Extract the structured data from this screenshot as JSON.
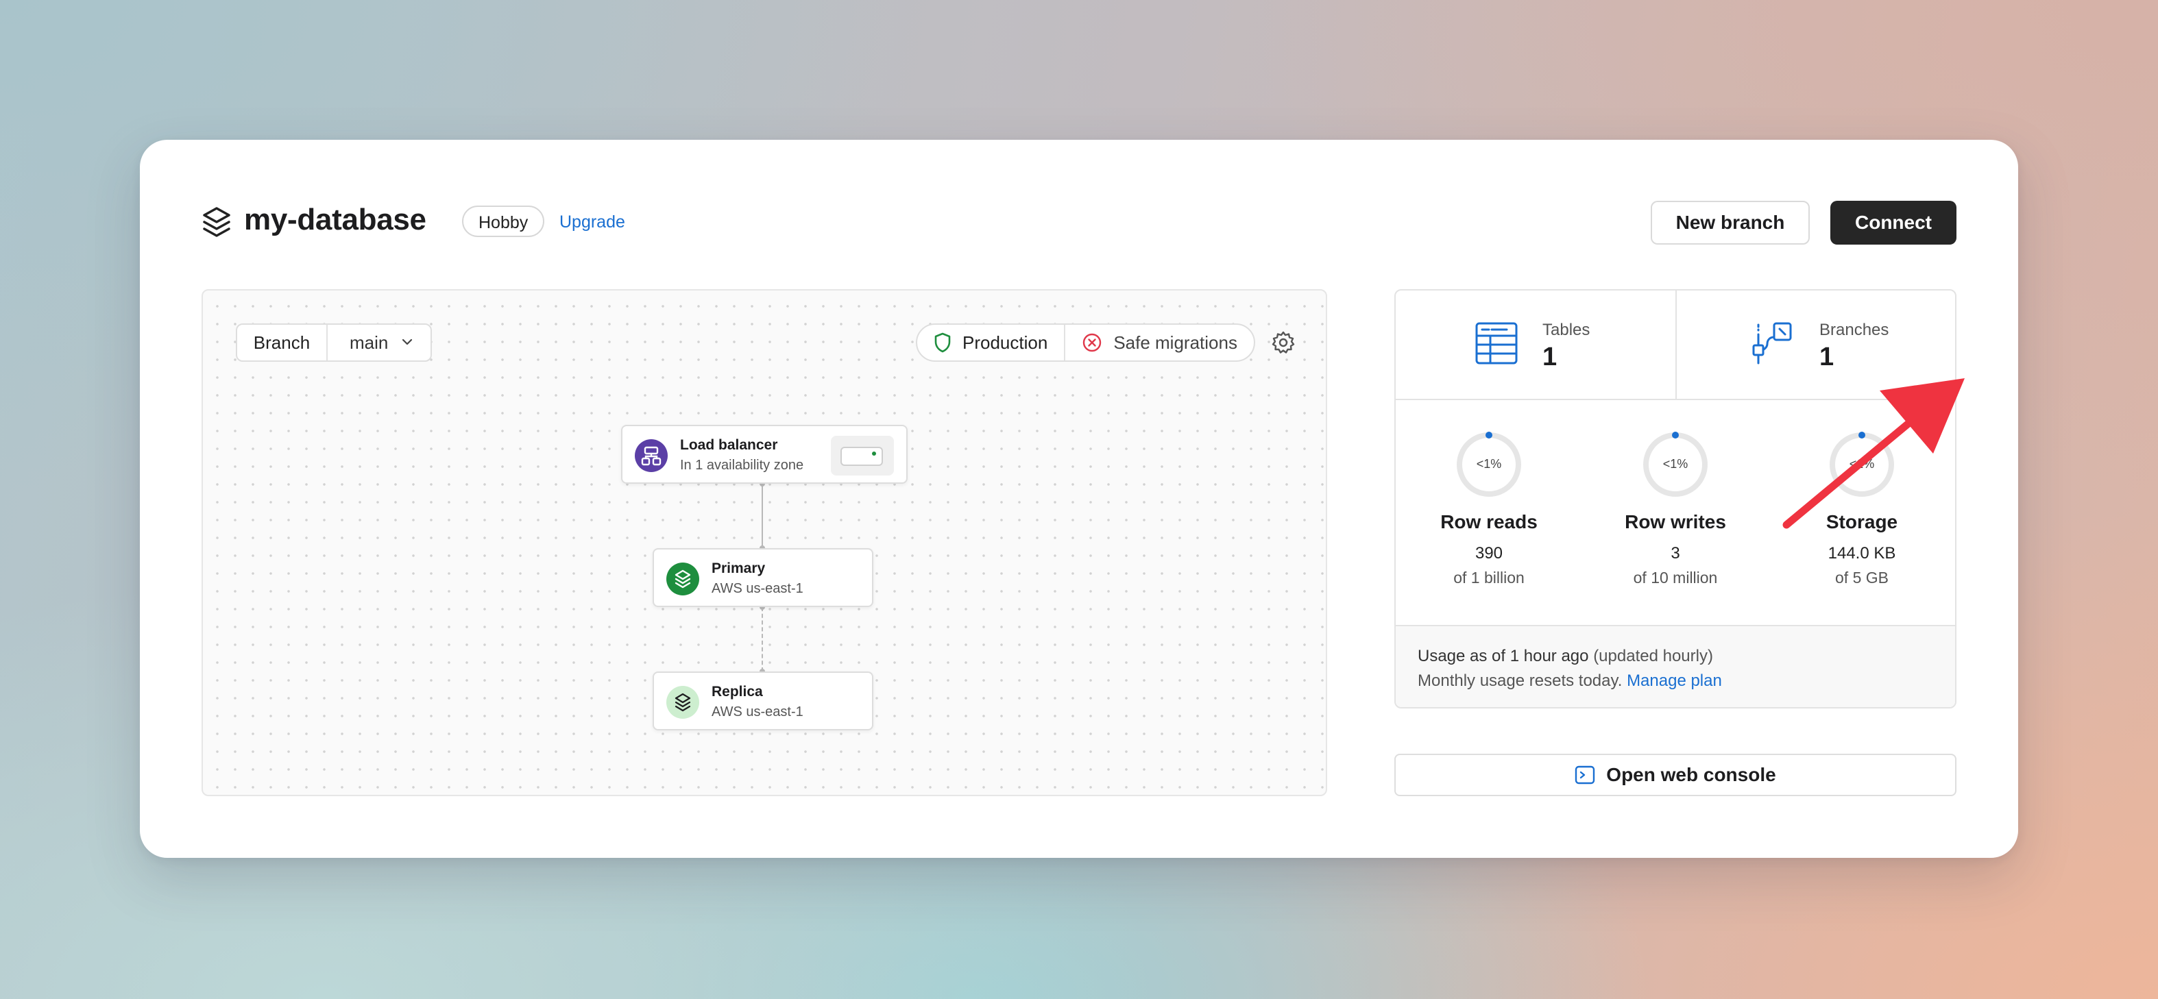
{
  "database": {
    "name": "my-database",
    "plan": "Hobby",
    "upgrade_label": "Upgrade"
  },
  "header_actions": {
    "new_branch_label": "New branch",
    "connect_label": "Connect"
  },
  "branch": {
    "label": "Branch",
    "value": "main"
  },
  "environment": {
    "production_label": "Production",
    "safe_migrations_label": "Safe migrations"
  },
  "diagram": {
    "load_balancer": {
      "title": "Load balancer",
      "subtitle": "In 1 availability zone"
    },
    "primary": {
      "title": "Primary",
      "subtitle": "AWS us-east-1"
    },
    "replica": {
      "title": "Replica",
      "subtitle": "AWS us-east-1"
    }
  },
  "stats": {
    "tables": {
      "label": "Tables",
      "value": "1"
    },
    "branches": {
      "label": "Branches",
      "value": "1"
    },
    "metrics": [
      {
        "name": "Row reads",
        "percent": "<1%",
        "value": "390",
        "limit": "of 1 billion"
      },
      {
        "name": "Row writes",
        "percent": "<1%",
        "value": "3",
        "limit": "of 10 million"
      },
      {
        "name": "Storage",
        "percent": "<1%",
        "value": "144.0 KB",
        "limit": "of 5 GB"
      }
    ],
    "usage": {
      "as_of": "Usage as of 1 hour ago",
      "update_note": "(updated hourly)",
      "reset_note": "Monthly usage resets today.",
      "manage_plan_label": "Manage plan"
    }
  },
  "console": {
    "label": "Open web console"
  },
  "colors": {
    "accent_blue": "#1a6fd1",
    "connect_bg": "#262626",
    "annotation_red": "#ef3340",
    "lb_purple": "#5b3fa6",
    "primary_green": "#1e8e3e",
    "replica_mint": "#cdeecf"
  }
}
